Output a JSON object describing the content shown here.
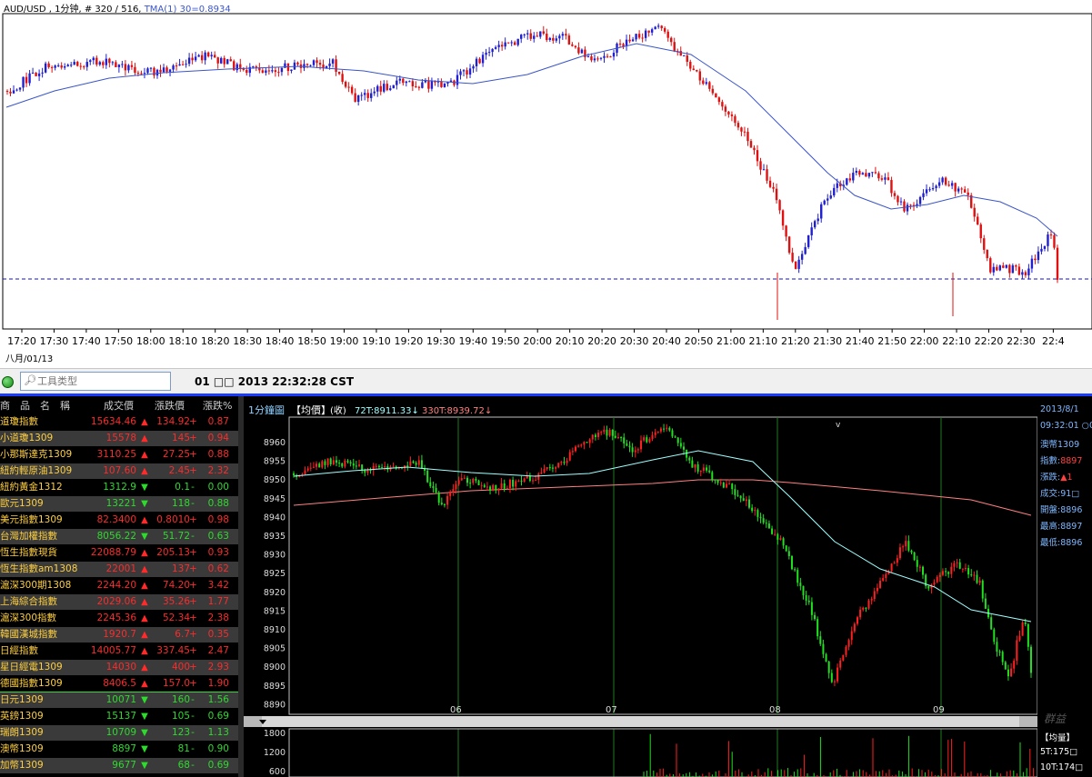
{
  "top_chart": {
    "title_prefix": "AUD/USD , 1分钟, # 320 / 516,",
    "indicator": "TMA(1) 30=0.8934",
    "date": "八月/01/13",
    "x_labels": [
      "17:20",
      "17:30",
      "17:40",
      "17:50",
      "18:00",
      "18:10",
      "18:20",
      "18:30",
      "18:40",
      "18:50",
      "19:00",
      "19:10",
      "19:20",
      "19:30",
      "19:40",
      "19:50",
      "20:00",
      "20:10",
      "20:20",
      "20:30",
      "20:40",
      "20:50",
      "21:00",
      "21:10",
      "21:20",
      "21:30",
      "21:40",
      "21:50",
      "22:00",
      "22:10",
      "22:20",
      "22:30",
      "22:4"
    ],
    "colors": {
      "up": "#2020d0",
      "down": "#e01010",
      "tma": "#3a55c8"
    }
  },
  "toolbar": {
    "search_placeholder": "工具类型",
    "datetime": "01 □□ 2013 22:32:28 CST"
  },
  "quotes": {
    "headers": [
      "商　品　名　稱",
      "成交價",
      "漲跌價",
      "漲跌%"
    ],
    "rows": [
      {
        "name": "道瓊指數",
        "price": "15634.46",
        "dir": "up",
        "change": "134.92",
        "sign": "+",
        "pct": "0.87"
      },
      {
        "name": "小道瓊1309",
        "price": "15578",
        "dir": "up",
        "change": "145",
        "sign": "+",
        "pct": "0.94"
      },
      {
        "name": "小那斯達克1309",
        "price": "3110.25",
        "dir": "up",
        "change": "27.25",
        "sign": "+",
        "pct": "0.88"
      },
      {
        "name": "紐約輕原油1309",
        "price": "107.60",
        "dir": "up",
        "change": "2.45",
        "sign": "+",
        "pct": "2.32"
      },
      {
        "name": "紐約黃金1312",
        "price": "1312.9",
        "dir": "dn",
        "change": "0.1",
        "sign": "-",
        "pct": "0.00"
      },
      {
        "name": "歐元1309",
        "price": "13221",
        "dir": "dn",
        "change": "118",
        "sign": "-",
        "pct": "0.88"
      },
      {
        "name": "美元指數1309",
        "price": "82.3400",
        "dir": "up",
        "change": "0.8010",
        "sign": "+",
        "pct": "0.98"
      },
      {
        "name": "台灣加權指數",
        "price": "8056.22",
        "dir": "dn",
        "change": "51.72",
        "sign": "-",
        "pct": "0.63"
      },
      {
        "name": "恆生指數現貨",
        "price": "22088.79",
        "dir": "up",
        "change": "205.13",
        "sign": "+",
        "pct": "0.93"
      },
      {
        "name": "恆生指數am1308",
        "price": "22001",
        "dir": "up",
        "change": "137",
        "sign": "+",
        "pct": "0.62"
      },
      {
        "name": "滬深300期1308",
        "price": "2244.20",
        "dir": "up",
        "change": "74.20",
        "sign": "+",
        "pct": "3.42"
      },
      {
        "name": "上海綜合指數",
        "price": "2029.06",
        "dir": "up",
        "change": "35.26",
        "sign": "+",
        "pct": "1.77"
      },
      {
        "name": "滬深300指數",
        "price": "2245.36",
        "dir": "up",
        "change": "52.34",
        "sign": "+",
        "pct": "2.38"
      },
      {
        "name": "韓國漢城指數",
        "price": "1920.7",
        "dir": "up",
        "change": "6.7",
        "sign": "+",
        "pct": "0.35"
      },
      {
        "name": "日經指數",
        "price": "14005.77",
        "dir": "up",
        "change": "337.45",
        "sign": "+",
        "pct": "2.47"
      },
      {
        "name": "星日經電1309",
        "price": "14030",
        "dir": "up",
        "change": "400",
        "sign": "+",
        "pct": "2.93"
      },
      {
        "name": "德國指數1309",
        "price": "8406.5",
        "dir": "up",
        "change": "157.0",
        "sign": "+",
        "pct": "1.90"
      },
      {
        "name": "日元1309",
        "price": "10071",
        "dir": "dn",
        "change": "160",
        "sign": "-",
        "pct": "1.56"
      },
      {
        "name": "英鎊1309",
        "price": "15137",
        "dir": "dn",
        "change": "105",
        "sign": "-",
        "pct": "0.69"
      },
      {
        "name": "瑞朗1309",
        "price": "10709",
        "dir": "dn",
        "change": "123",
        "sign": "-",
        "pct": "1.13"
      },
      {
        "name": "澳幣1309",
        "price": "8897",
        "dir": "dn",
        "change": "81",
        "sign": "-",
        "pct": "0.90"
      },
      {
        "name": "加幣1309",
        "price": "9677",
        "dir": "dn",
        "change": "68",
        "sign": "-",
        "pct": "0.69"
      }
    ]
  },
  "bottom_chart": {
    "label": "1分鐘圖",
    "mode": "【均價】",
    "close_label": "(收)",
    "ma1": "72T:8911.33↓",
    "ma2": "330T:8939.72↓",
    "y_labels": [
      "8960",
      "8955",
      "8950",
      "8945",
      "8940",
      "8935",
      "8930",
      "8925",
      "8920",
      "8915",
      "8910",
      "8905",
      "8900",
      "8895",
      "8890"
    ],
    "x_labels": [
      "06",
      "07",
      "08",
      "09"
    ],
    "volume_labels": [
      "1800",
      "1200",
      "600"
    ],
    "colors": {
      "up": "#ff2020",
      "down": "#20e020",
      "ma1": "#a0ffff",
      "ma2": "#ff8080"
    }
  },
  "side_panel": {
    "date": "2013/8/1",
    "time": "09:32:01 ○0",
    "name": "澳幣1309",
    "index_label": "指數",
    "index_value": "8897",
    "change_label": "漲跌",
    "change_value": "▲1",
    "volume_label": "成交",
    "volume_value": "91□",
    "open_label": "開盤",
    "open_value": "8896",
    "high_label": "最高",
    "high_value": "8897",
    "low_label": "最低",
    "low_value": "8896"
  },
  "side_panel2": {
    "title": "【均量】",
    "v1": "5T:175□",
    "v2": "10T:174□"
  },
  "watermark": "群益"
}
